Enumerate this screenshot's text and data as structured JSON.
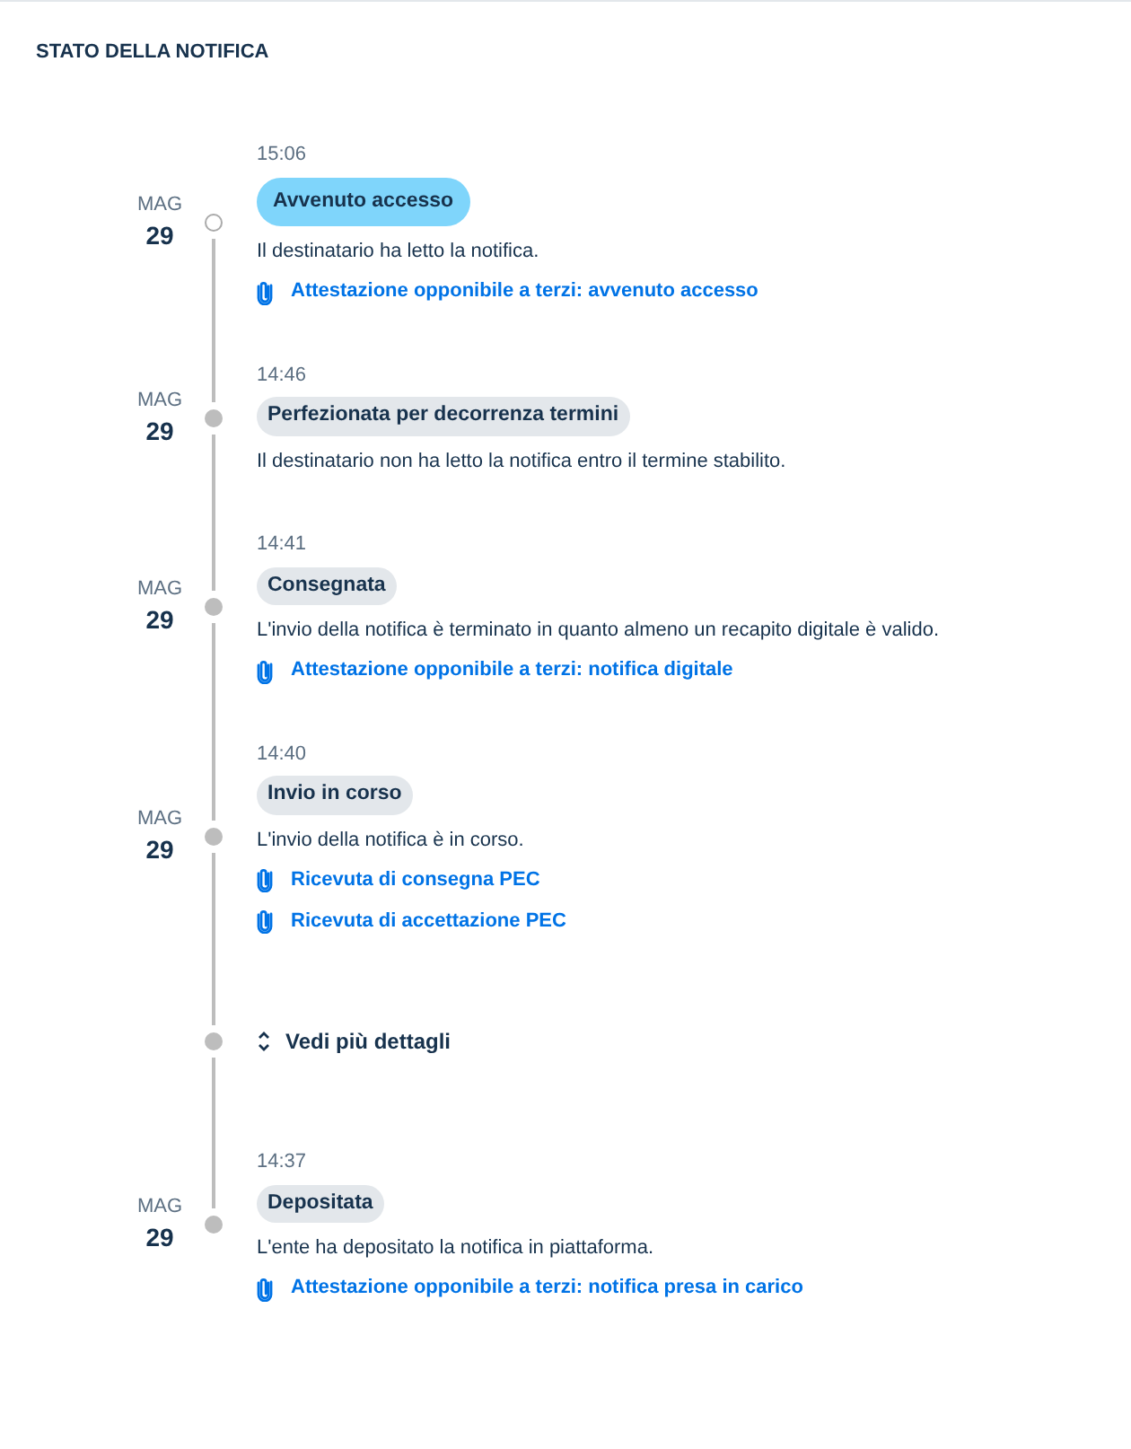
{
  "title": "STATO DELLA NOTIFICA",
  "timeline": [
    {
      "kind": "step",
      "month": "MAG",
      "day": "29",
      "time": "15:06",
      "status": "Avvenuto accesso",
      "current": true,
      "description": "Il destinatario ha letto la notifica.",
      "links": [
        "Attestazione opponibile a terzi: avvenuto accesso"
      ]
    },
    {
      "kind": "step",
      "month": "MAG",
      "day": "29",
      "time": "14:46",
      "status": "Perfezionata per decorrenza termini",
      "current": false,
      "description": "Il destinatario non ha letto la notifica entro il termine stabilito."
    },
    {
      "kind": "step",
      "month": "MAG",
      "day": "29",
      "time": "14:41",
      "status": "Consegnata",
      "current": false,
      "description": "L'invio della notifica è terminato in quanto almeno un recapito digitale è valido.",
      "links": [
        "Attestazione opponibile a terzi: notifica digitale"
      ]
    },
    {
      "kind": "step",
      "month": "MAG",
      "day": "29",
      "time": "14:40",
      "status": "Invio in corso",
      "current": false,
      "description": "L'invio della notifica è in corso.",
      "links": [
        "Ricevuta di consegna PEC",
        "Ricevuta di accettazione PEC"
      ]
    },
    {
      "kind": "more",
      "label": "Vedi più dettagli"
    },
    {
      "kind": "step",
      "month": "MAG",
      "day": "29",
      "time": "14:37",
      "status": "Depositata",
      "current": false,
      "description": "L'ente ha depositato la notifica in piattaforma.",
      "links": [
        "Attestazione opponibile a terzi: notifica presa in carico"
      ]
    }
  ]
}
